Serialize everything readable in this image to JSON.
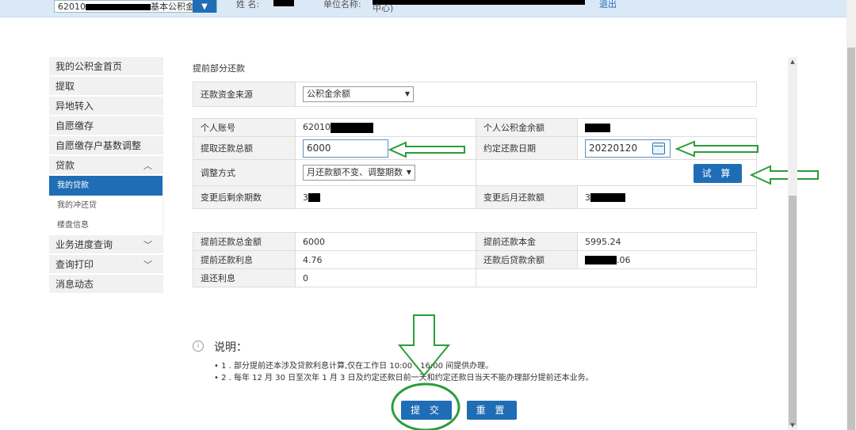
{
  "header": {
    "account_prefix": "62010",
    "account_suffix": "基本公积金",
    "name_label": "姓    名:",
    "unit_label": "单位名称:",
    "unit_suffix": "中心)",
    "logout": "退出"
  },
  "sidebar": {
    "items": [
      {
        "label": "我的公积金首页"
      },
      {
        "label": "提取"
      },
      {
        "label": "异地转入"
      },
      {
        "label": "自愿缴存"
      },
      {
        "label": "自愿缴存户基数调整"
      },
      {
        "label": "贷款",
        "chevron": "chevron-up-icon"
      },
      {
        "label": "业务进度查询",
        "chevron": "chevron-down-icon"
      },
      {
        "label": "查询打印",
        "chevron": "chevron-down-icon"
      },
      {
        "label": "消息动态"
      }
    ],
    "subitems": [
      {
        "label": "我的贷款",
        "active": true
      },
      {
        "label": "我的冲还贷"
      },
      {
        "label": "楼盘信息"
      }
    ]
  },
  "form": {
    "section_title": "提前部分还款",
    "source_label": "还款资金来源",
    "source_value": "公积金余额",
    "account_no_label": "个人账号",
    "account_no_prefix": "62010",
    "balance_label": "个人公积金余额",
    "total_label": "提取还款总额",
    "total_value": "6000",
    "date_label": "约定还款日期",
    "date_value": "20220120",
    "adjust_label": "调整方式",
    "adjust_value": "月还款额不变、调整期数",
    "trial_button": "试 算",
    "remain_periods_label": "变更后剩余期数",
    "remain_periods_prefix": "3",
    "monthly_label": "变更后月还款额",
    "monthly_prefix": "3"
  },
  "result": {
    "rows": [
      {
        "l1": "提前还款总金额",
        "v1": "6000",
        "l2": "提前还款本金",
        "v2": "5995.24"
      },
      {
        "l1": "提前还款利息",
        "v1": "4.76",
        "l2": "还款后贷款余额",
        "v2": ".06"
      },
      {
        "l1": "退还利息",
        "v1": "0"
      }
    ]
  },
  "notes": {
    "title": "说明：",
    "lines": [
      "• 1 . 部分提前还本涉及贷款利息计算,仅在工作日 10:00 - 16:00 间提供办理。",
      "• 2 . 每年 12 月 30 日至次年 1 月 3 日及约定还款日前一天和约定还款日当天不能办理部分提前还本业务。"
    ]
  },
  "actions": {
    "submit": "提 交",
    "reset": "重 置"
  },
  "colors": {
    "accent": "#1f6db4",
    "annotation": "#2a9d3a"
  }
}
